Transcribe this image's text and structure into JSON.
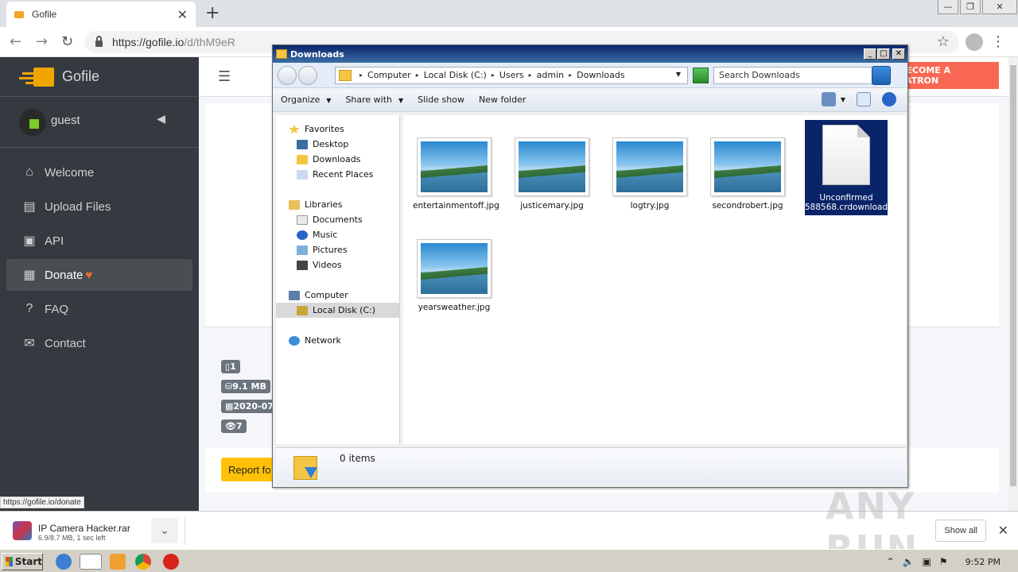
{
  "browser": {
    "tab_title": "Gofile",
    "url_host": "https://gofile.io",
    "url_path": "/d/thM9eR",
    "status_link": "https://gofile.io/donate"
  },
  "sidebar": {
    "brand": "Gofile",
    "user": "guest",
    "items": [
      {
        "label": "Welcome",
        "icon": "home-icon"
      },
      {
        "label": "Upload Files",
        "icon": "file-upload-icon"
      },
      {
        "label": "API",
        "icon": "api-icon"
      },
      {
        "label": "Donate",
        "icon": "gift-icon"
      },
      {
        "label": "FAQ",
        "icon": "question-icon"
      },
      {
        "label": "Contact",
        "icon": "envelope-icon"
      }
    ]
  },
  "content": {
    "patron_label": "BECOME A PATRON",
    "badges": [
      "1",
      "9.1 MB",
      "2020-07-",
      "7"
    ],
    "report_label": "Report fo"
  },
  "download": {
    "filename": "IP Camera Hacker.rar",
    "progress": "6.9/8.7 MB, 1 sec left",
    "show_all": "Show all"
  },
  "watermark": "ANY RUN",
  "explorer": {
    "title": "Downloads",
    "breadcrumbs": [
      "Computer",
      "Local Disk (C:)",
      "Users",
      "admin",
      "Downloads"
    ],
    "search_placeholder": "Search Downloads",
    "commands": [
      {
        "label": "Organize",
        "dropdown": true
      },
      {
        "label": "Share with",
        "dropdown": true
      },
      {
        "label": "Slide show",
        "dropdown": false
      },
      {
        "label": "New folder",
        "dropdown": false
      }
    ],
    "nav": {
      "favorites": "Favorites",
      "favorites_items": [
        "Desktop",
        "Downloads",
        "Recent Places"
      ],
      "libraries": "Libraries",
      "libraries_items": [
        "Documents",
        "Music",
        "Pictures",
        "Videos"
      ],
      "computer": "Computer",
      "computer_items": [
        "Local Disk (C:)"
      ],
      "network": "Network"
    },
    "files": [
      {
        "name": "entertainmentoff.jpg",
        "type": "image"
      },
      {
        "name": "justicemary.jpg",
        "type": "image"
      },
      {
        "name": "logtry.jpg",
        "type": "image"
      },
      {
        "name": "secondrobert.jpg",
        "type": "image"
      },
      {
        "name": "Unconfirmed 588568.crdownload",
        "type": "document",
        "selected": true
      },
      {
        "name": "yearsweather.jpg",
        "type": "image"
      }
    ],
    "details": "0 items"
  },
  "taskbar": {
    "start": "Start",
    "clock": "9:52 PM"
  }
}
